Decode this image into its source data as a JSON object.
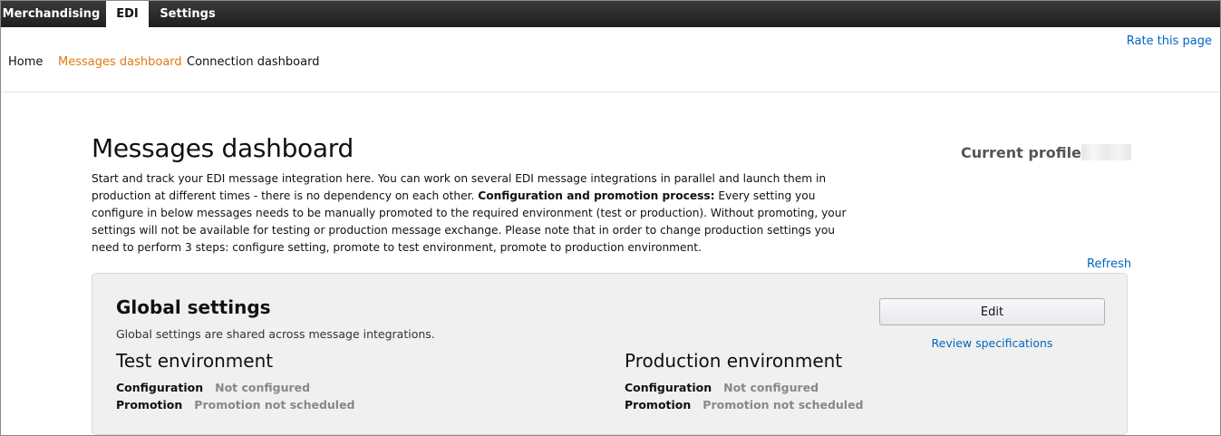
{
  "topnav": {
    "tabs": [
      {
        "label": "Merchandising",
        "active": false
      },
      {
        "label": "EDI",
        "active": true
      },
      {
        "label": "Settings",
        "active": false
      }
    ]
  },
  "subnav": {
    "links": [
      {
        "label": "Home",
        "active": false
      },
      {
        "label": "Messages dashboard",
        "active": true
      },
      {
        "label": "Connection dashboard",
        "active": false
      }
    ],
    "rate_link": "Rate this page"
  },
  "header": {
    "title": "Messages dashboard",
    "profile_label": "Current profile",
    "intro": {
      "text1": "Start and track your EDI message integration here. You can work on several EDI message integrations in parallel and launch them in production at different times - there is no dependency on each other.",
      "bold": "Configuration and promotion process:",
      "text2": "Every setting you configure in below messages needs to be manually promoted to the required environment (test or production). Without promoting, your settings will not be available for testing or production message exchange. Please note that in order to change production settings you need to perform 3 steps: configure setting, promote to test environment, promote to production environment."
    },
    "refresh_label": "Refresh"
  },
  "global_settings": {
    "title": "Global settings",
    "description": "Global settings are shared across message integrations.",
    "edit_label": "Edit",
    "review_label": "Review specifications",
    "environments": [
      {
        "title": "Test environment",
        "configuration_label": "Configuration",
        "configuration_value": "Not configured",
        "promotion_label": "Promotion",
        "promotion_value": "Promotion not scheduled"
      },
      {
        "title": "Production environment",
        "configuration_label": "Configuration",
        "configuration_value": "Not configured",
        "promotion_label": "Promotion",
        "promotion_value": "Promotion not scheduled"
      }
    ]
  },
  "colors": {
    "nav_bg": "#232323",
    "active_link": "#e47911",
    "link": "#0066c0",
    "panel_bg": "#f0f0f0",
    "muted_value": "#888888"
  }
}
